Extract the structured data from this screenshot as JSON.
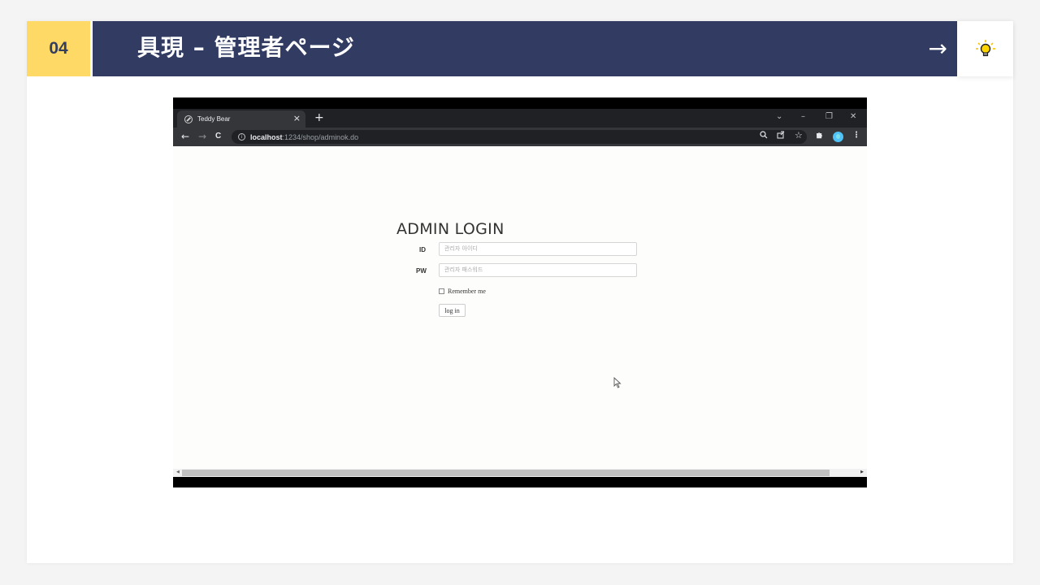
{
  "slide": {
    "number": "04",
    "title": "具現 – 管理者ページ",
    "arrow": "→",
    "accent_color": "#ffd966",
    "header_color": "#323c63",
    "bulb_icon": "lightbulb-icon"
  },
  "browser": {
    "tab_title": "Teddy Bear",
    "tab_close": "×",
    "new_tab": "+",
    "url_host": "localhost",
    "url_path": ":1234/shop/adminok.do",
    "window_controls": [
      "⌄",
      "–",
      "❐",
      "✕"
    ],
    "nav": {
      "back": "←",
      "forward": "→",
      "reload": "C"
    },
    "toolbar_icons": [
      "zoom-icon",
      "share-icon",
      "star-icon",
      "extensions-icon",
      "profile-icon",
      "menu-icon"
    ]
  },
  "login": {
    "title": "ADMIN LOGIN",
    "id_label": "ID",
    "id_placeholder": "관리자 아이디",
    "pw_label": "PW",
    "pw_placeholder": "관리자 패스워드",
    "remember_label": "Remember me",
    "submit_label": "log in"
  }
}
